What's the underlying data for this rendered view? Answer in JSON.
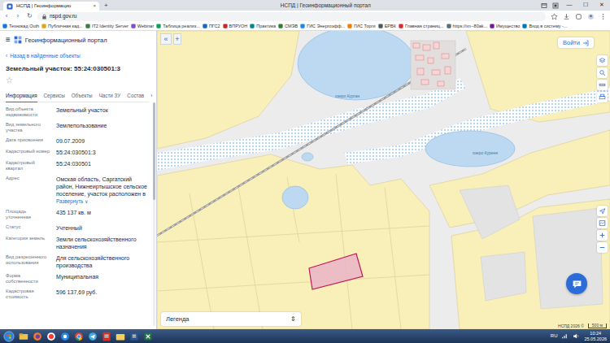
{
  "browser": {
    "tabs": [
      {
        "label": "НСПД | Геоинформацио",
        "close": "×",
        "selected": true
      }
    ],
    "new_tab": "+",
    "title": "НСПД | Геоинформационный портал",
    "window_buttons": [
      "—",
      "☐",
      "✕"
    ],
    "nav_buttons": [
      "‹",
      "›",
      "↻"
    ],
    "address": "nspd.gov.ru",
    "bookmarks": [
      "Технокад Оuth",
      "Публичная кад...",
      "IT2 Identity Server",
      "Webinar",
      "Таблица реализ...",
      "ПГС2",
      "ВПРУОН",
      "Практика",
      "СМЭВ",
      "ГИС Энергоэфф...",
      "ГИС Торги",
      "ЕРВК",
      "Главная страниц...",
      "https://xn--80ak...",
      "Имущество",
      "Вход в систему -..."
    ]
  },
  "panel": {
    "menu": "≡",
    "portal_title": "Геоинформационный портал",
    "back": {
      "arrow": "‹",
      "label": "Назад в найденные объекты"
    },
    "heading": "Земельный участок: 55:24:030501:3",
    "favorite": "☆",
    "tabs": [
      {
        "label": "Информация",
        "selected": true
      },
      {
        "label": "Сервисы",
        "selected": false
      },
      {
        "label": "Объекты",
        "selected": false
      },
      {
        "label": "Части ЗУ",
        "selected": false
      },
      {
        "label": "Состав",
        "selected": false
      }
    ],
    "tabs_more": "›",
    "fields": [
      {
        "label": "Вид объекта недвижимости",
        "value": "Земельный участок"
      },
      {
        "label": "Вид земельного участка",
        "value": "Землепользование"
      },
      {
        "label": "Дата присвоения",
        "value": "09.07.2009"
      },
      {
        "label": "Кадастровый номер",
        "value": "55:24:030501:3"
      },
      {
        "label": "Кадастровый квартал",
        "value": "55:24:030501"
      },
      {
        "label": "Адрес",
        "value": "Омская область, Саргатский район, Нижнеиртышское сельское поселение, участок расположен в",
        "expand": {
          "label": "Развернуть",
          "arrow": "∨"
        }
      },
      {
        "label": "Площадь уточненная",
        "value": "435 137 кв. м"
      },
      {
        "label": "Статус",
        "value": "Учтенный"
      },
      {
        "label": "Категория земель",
        "value": "Земли сельскохозяйственного назначения"
      },
      {
        "label": "Вид разрешенного использования",
        "value": "Для сельскохозяйственного производства"
      },
      {
        "label": "Форма собственности",
        "value": "Муниципальная"
      },
      {
        "label": "Кадастровая стоимость",
        "value": "596 137,69 руб."
      }
    ]
  },
  "map": {
    "collapse": "«",
    "add": "+",
    "login": "Войти",
    "labels": [
      {
        "text": "озеро Курган"
      },
      {
        "text": "озеро Куреня"
      }
    ],
    "parcel": {
      "highlighted": true
    },
    "legend": {
      "label": "Легенда",
      "toggle": "⇕"
    },
    "attribution": "НСПД 2026 ©",
    "scale": "500 м"
  },
  "taskbar": {
    "language": "RU",
    "time": "10:24",
    "date": "25.05.2026"
  }
}
